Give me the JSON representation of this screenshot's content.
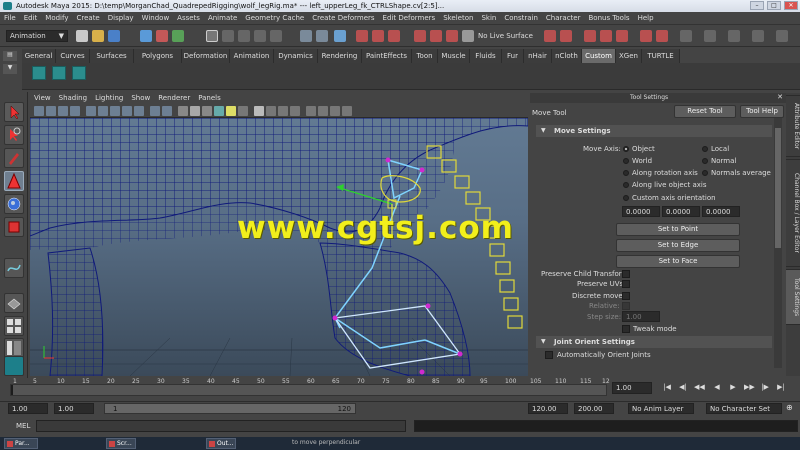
{
  "window": {
    "title": "Autodesk Maya 2015: D:\\temp\\MorganChad_QuadrepedRigging\\wolf_legRig.ma*   ---   left_upperLeg_fk_CTRLShape.cv[2:5]...",
    "minimize": "–",
    "maximize": "□",
    "close": "✕"
  },
  "menubar": [
    "File",
    "Edit",
    "Modify",
    "Create",
    "Display",
    "Window",
    "Assets",
    "Animate",
    "Geometry Cache",
    "Create Deformers",
    "Edit Deformers",
    "Skeleton",
    "Skin",
    "Constrain",
    "Character",
    "Bonus Tools",
    "Help"
  ],
  "statusline": {
    "mode": "Animation",
    "live_surface": "No Live Surface"
  },
  "shelf": {
    "tabs": [
      "General",
      "Curves",
      "Surfaces",
      "Polygons",
      "Deformation",
      "Animation",
      "Dynamics",
      "Rendering",
      "PaintEffects",
      "Toon",
      "Muscle",
      "Fluids",
      "Fur",
      "nHair",
      "nCloth",
      "Custom",
      "XGen",
      "TURTLE"
    ],
    "active_tab": "Custom"
  },
  "panel": {
    "menu": [
      "View",
      "Shading",
      "Lighting",
      "Show",
      "Renderer",
      "Panels"
    ]
  },
  "watermark": "www.cgtsj.com",
  "tool_settings": {
    "header": "Tool Settings",
    "tool_name": "Move Tool",
    "reset_button": "Reset Tool",
    "help_button": "Tool Help",
    "move_settings": {
      "title": "Move Settings",
      "axis_label": "Move Axis:",
      "axis_options_left": [
        "Object",
        "World",
        "Along rotation axis",
        "Along live object axis",
        "Custom axis orientation"
      ],
      "axis_options_right": [
        "Local",
        "Normal",
        "Normals average"
      ],
      "selected": "Object",
      "values": [
        "0.0000",
        "0.0000",
        "0.0000"
      ],
      "set_to_point": "Set to Point",
      "set_to_edge": "Set to Edge",
      "set_to_face": "Set to Face",
      "preserve_child": "Preserve Child Transform",
      "preserve_uvs": "Preserve UVs",
      "discrete_move": "Discrete move:",
      "relative": "Relative:",
      "step_size_label": "Step size:",
      "step_size": "1.00",
      "tweak_mode": "Tweak mode"
    },
    "joint_orient": {
      "title": "Joint Orient Settings",
      "auto_orient": "Automatically Orient Joints"
    }
  },
  "side_tabs": [
    "Attribute Editor",
    "Channel Box / Layer Editor",
    "Tool Settings"
  ],
  "timeline": {
    "ticks": [
      "5",
      "10",
      "15",
      "20",
      "25",
      "30",
      "35",
      "40",
      "45",
      "50",
      "55",
      "60",
      "65",
      "70",
      "75",
      "80",
      "85",
      "90",
      "95",
      "100",
      "105",
      "110",
      "115",
      "12"
    ],
    "start_tick": "1",
    "current_frame": "1.00"
  },
  "range": {
    "start": "1.00",
    "start2": "1.00",
    "range_start_label": "1",
    "range_end_label": "120",
    "end": "120.00",
    "end2": "200.00",
    "anim_layer": "No Anim Layer",
    "character_set": "No Character Set"
  },
  "command": {
    "label": "MEL",
    "help_text": "to move perpendicular"
  },
  "taskbar": [
    "Par...",
    "Scr...",
    "Out..."
  ],
  "colors": {
    "watermark": "#f2ef1b",
    "wireframe": "#101a7a",
    "joint": "#7fd3ff",
    "control_curve": "#e0d83a"
  }
}
